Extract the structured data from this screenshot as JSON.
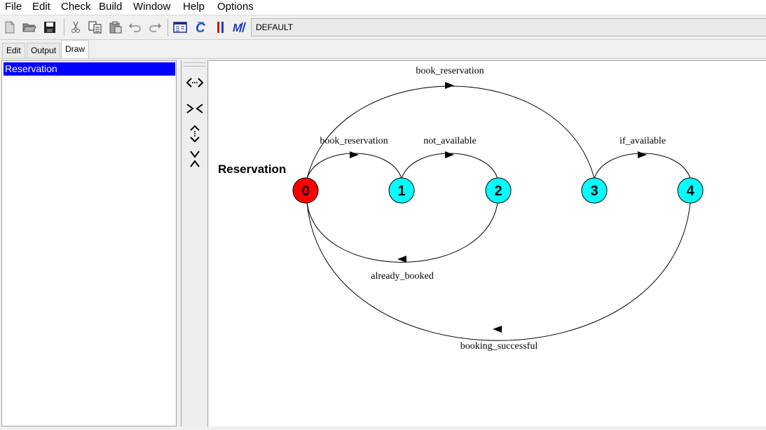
{
  "menu": [
    "File",
    "Edit",
    "Check",
    "Build",
    "Window",
    "Help",
    "Options"
  ],
  "toolbar": {
    "icons": [
      "new-file-icon",
      "open-folder-icon",
      "save-icon",
      "cut-icon",
      "copy-icon",
      "paste-icon",
      "undo-icon",
      "redo-icon",
      "window-icon",
      "compile-icon",
      "parallel-icon",
      "minimise-icon"
    ],
    "target": "DEFAULT"
  },
  "tabs": [
    "Edit",
    "Output",
    "Draw"
  ],
  "active_tab": "Draw",
  "process_list": [
    "Reservation"
  ],
  "lts": {
    "process_name": "Reservation",
    "states": [
      {
        "id": "0",
        "color": "#ff0000"
      },
      {
        "id": "1",
        "color": "#00ffff"
      },
      {
        "id": "2",
        "color": "#00ffff"
      },
      {
        "id": "3",
        "color": "#00ffff"
      },
      {
        "id": "4",
        "color": "#00ffff"
      }
    ],
    "transitions": [
      {
        "from": "0",
        "to": "3",
        "label": "book_reservation"
      },
      {
        "from": "0",
        "to": "1",
        "label": "book_reservation"
      },
      {
        "from": "1",
        "to": "2",
        "label": "not_available"
      },
      {
        "from": "3",
        "to": "4",
        "label": "if_available"
      },
      {
        "from": "2",
        "to": "0",
        "label": "already_booked"
      },
      {
        "from": "4",
        "to": "0",
        "label": "booking_successful"
      }
    ]
  }
}
